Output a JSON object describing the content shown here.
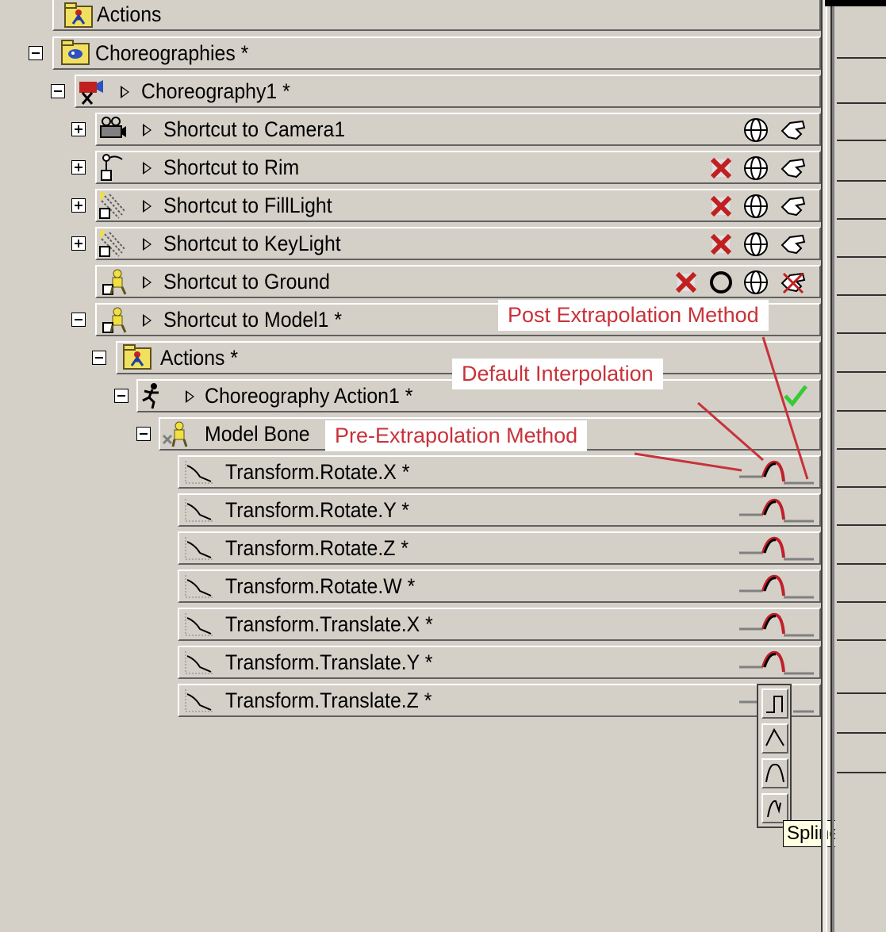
{
  "tree": {
    "actions_root": "Actions",
    "choreographies": "Choreographies *",
    "choreography1": "Choreography1 *",
    "camera": "Shortcut to Camera1",
    "rim": "Shortcut to Rim",
    "filllight": "Shortcut to FillLight",
    "keylight": "Shortcut to KeyLight",
    "ground": "Shortcut to Ground",
    "model1": "Shortcut to Model1 *",
    "actions": "Actions *",
    "choreo_action": "Choreography Action1 *",
    "model_bones": "Model Bone",
    "channels": [
      "Transform.Rotate.X *",
      "Transform.Rotate.Y *",
      "Transform.Rotate.Z *",
      "Transform.Rotate.W *",
      "Transform.Translate.X *",
      "Transform.Translate.Y *",
      "Transform.Translate.Z *"
    ]
  },
  "annotations": {
    "post": "Post Extrapolation Method",
    "default": "Default Interpolation",
    "pre": "Pre-Extrapolation Method"
  },
  "tooltip": "Spline",
  "colors": {
    "callout_text": "#c8323a",
    "curve_red": "#c0202a",
    "check_green": "#33cc33"
  },
  "icons": [
    "folder-actions-icon",
    "choreography-folder-icon",
    "clapper-icon",
    "camera-icon",
    "light-icon",
    "model-figure-icon",
    "running-man-icon",
    "bone-icon",
    "channel-curve-icon",
    "wireframe-sphere-icon",
    "hand-icon",
    "red-x-icon",
    "check-icon"
  ]
}
